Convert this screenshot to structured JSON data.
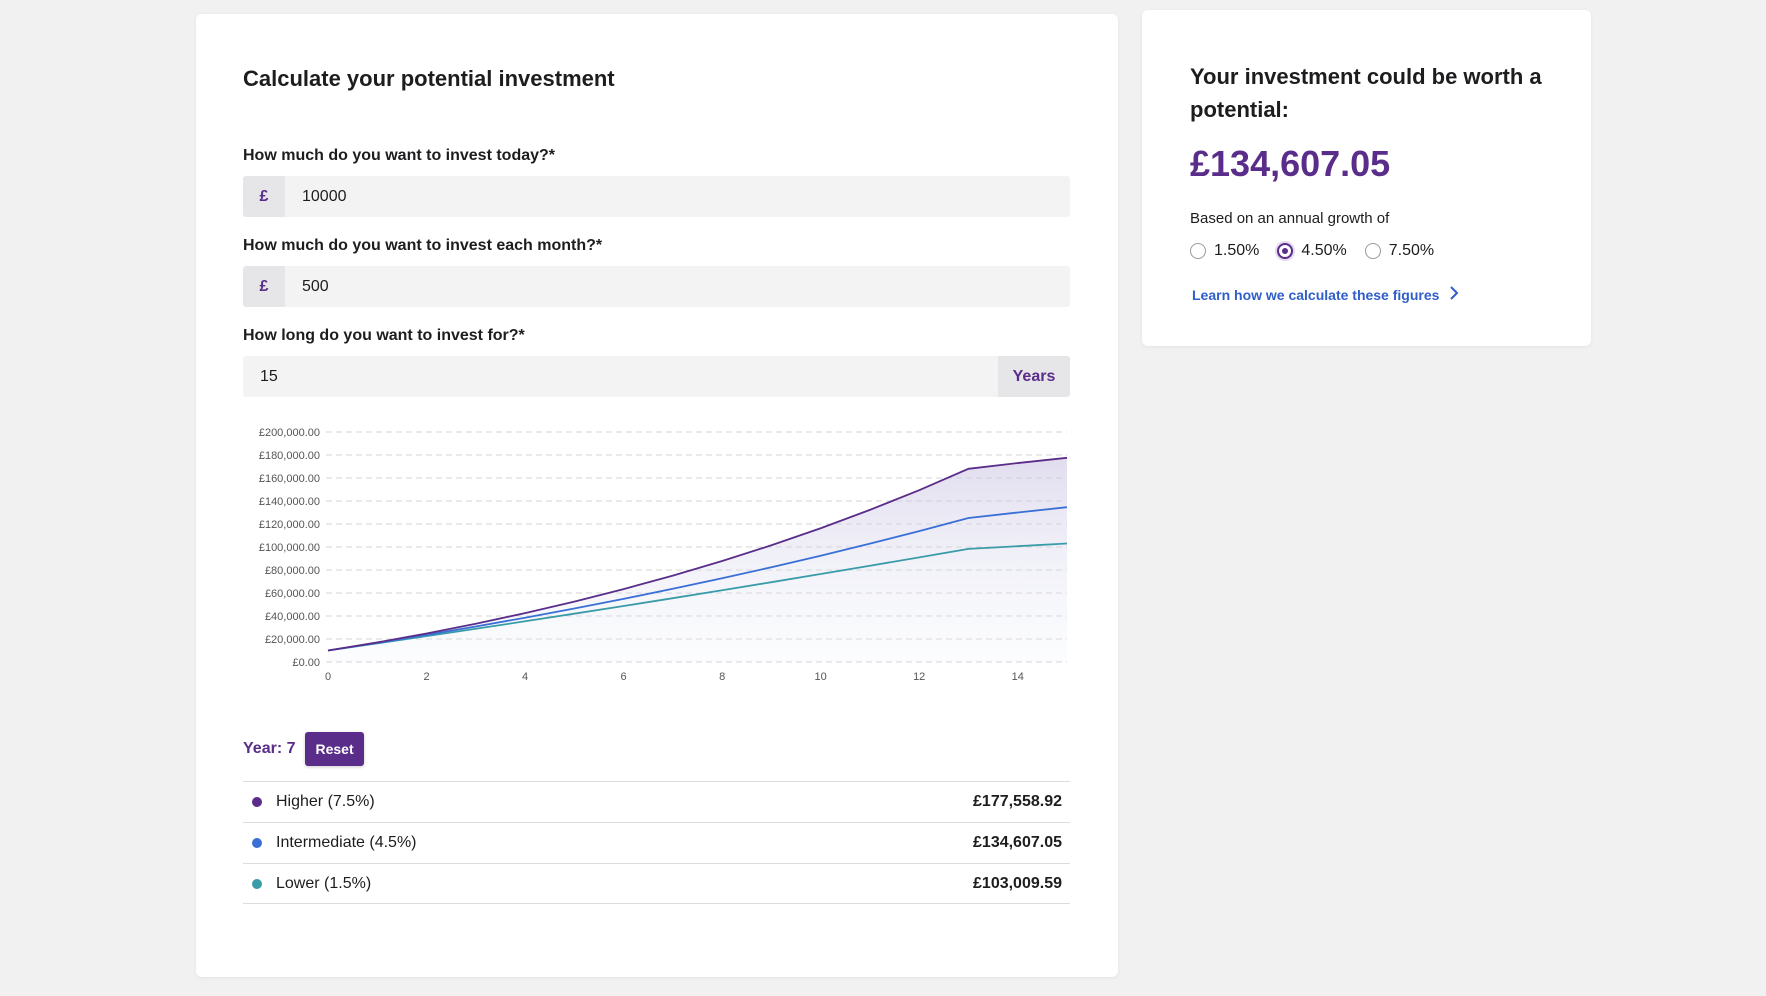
{
  "calculator": {
    "title": "Calculate your potential investment",
    "initial": {
      "label": "How much do you want to invest today?*",
      "prefix": "£",
      "value": "10000"
    },
    "monthly": {
      "label": "How much do you want to invest each month?*",
      "prefix": "£",
      "value": "500"
    },
    "duration": {
      "label": "How long do you want to invest for?*",
      "value": "15",
      "suffix": "Years"
    },
    "year_label": "Year: 7",
    "reset_label": "Reset",
    "legend": [
      {
        "name": "Higher (7.5%)",
        "value": "£177,558.92",
        "color": "#5a2d8a"
      },
      {
        "name": "Intermediate (4.5%)",
        "value": "£134,607.05",
        "color": "#3a6fd6"
      },
      {
        "name": "Lower (1.5%)",
        "value": "£103,009.59",
        "color": "#3a9ca8"
      }
    ]
  },
  "result": {
    "heading": "Your investment could be worth a potential:",
    "amount": "£134,607.05",
    "growth_label": "Based on an annual growth of",
    "options": [
      {
        "label": "1.50%",
        "checked": false
      },
      {
        "label": "4.50%",
        "checked": true
      },
      {
        "label": "7.50%",
        "checked": false
      }
    ],
    "link_label": "Learn how we calculate these figures"
  },
  "chart_data": {
    "type": "line",
    "x": [
      0,
      1,
      2,
      3,
      4,
      5,
      6,
      7,
      8,
      9,
      10,
      11,
      12,
      13,
      14,
      15
    ],
    "xticks": [
      0,
      2,
      4,
      6,
      8,
      10,
      12,
      14
    ],
    "yticks": [
      "£0.00",
      "£20,000.00",
      "£40,000.00",
      "£60,000.00",
      "£80,000.00",
      "£100,000.00",
      "£120,000.00",
      "£140,000.00",
      "£160,000.00",
      "£180,000.00",
      "£200,000.00"
    ],
    "ylim": [
      0,
      200000
    ],
    "xlim": [
      0,
      15
    ],
    "grid": true,
    "series": [
      {
        "name": "Higher (7.5%)",
        "color": "#5a2d8a",
        "values": [
          10000,
          17000,
          24800,
          33300,
          42500,
          52500,
          63400,
          75100,
          87800,
          101500,
          116300,
          132300,
          149400,
          168000,
          173000,
          177559
        ]
      },
      {
        "name": "Intermediate (4.5%)",
        "color": "#3a6fd6",
        "values": [
          10000,
          16600,
          23600,
          30900,
          38500,
          46500,
          54900,
          63700,
          72800,
          82400,
          92400,
          102900,
          113800,
          125200,
          130000,
          134607
        ]
      },
      {
        "name": "Lower (1.5%)",
        "color": "#3a9ca8",
        "values": [
          10000,
          16200,
          22500,
          28900,
          35400,
          42000,
          48700,
          55500,
          62400,
          69400,
          76500,
          83700,
          91000,
          98400,
          100700,
          103010
        ]
      }
    ]
  }
}
